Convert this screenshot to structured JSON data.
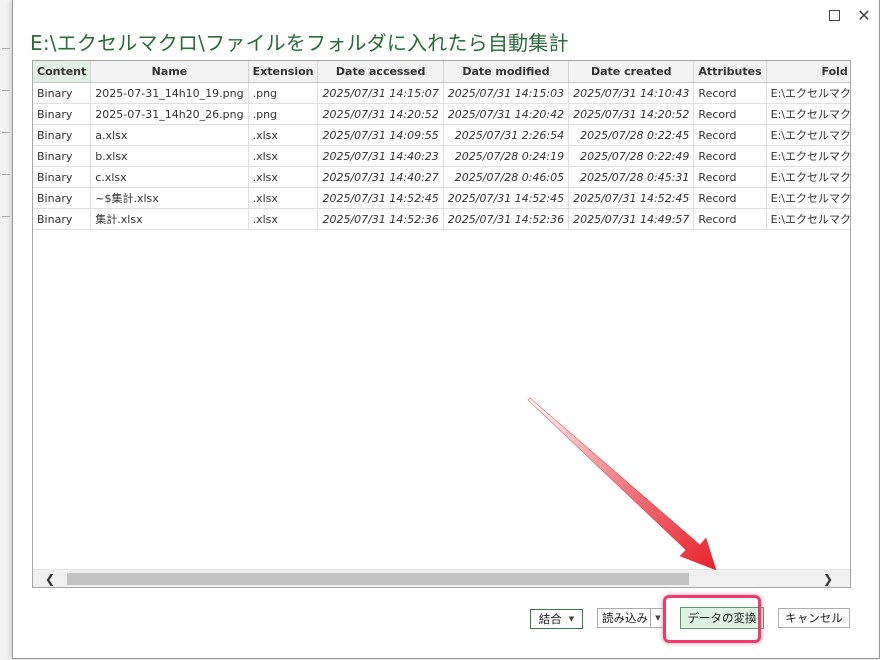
{
  "window": {
    "title": "E:\\エクセルマクロ\\ファイルをフォルダに入れたら自動集計",
    "controls": {
      "maximize_icon": "maximize-icon",
      "close_icon": "close-icon",
      "close_glyph": "✕"
    }
  },
  "table": {
    "columns": [
      "Content",
      "Name",
      "Extension",
      "Date accessed",
      "Date modified",
      "Date created",
      "Attributes",
      "Fold"
    ],
    "rows": [
      {
        "content": "Binary",
        "name": "2025-07-31_14h10_19.png",
        "extension": ".png",
        "date_accessed": "2025/07/31 14:15:07",
        "date_modified": "2025/07/31 14:15:03",
        "date_created": "2025/07/31 14:10:43",
        "attributes": "Record",
        "folder": "E:\\エクセルマクロ\\ファイ"
      },
      {
        "content": "Binary",
        "name": "2025-07-31_14h20_26.png",
        "extension": ".png",
        "date_accessed": "2025/07/31 14:20:52",
        "date_modified": "2025/07/31 14:20:42",
        "date_created": "2025/07/31 14:20:52",
        "attributes": "Record",
        "folder": "E:\\エクセルマクロ\\ファイ"
      },
      {
        "content": "Binary",
        "name": "a.xlsx",
        "extension": ".xlsx",
        "date_accessed": "2025/07/31 14:09:55",
        "date_modified": "2025/07/31 2:26:54",
        "date_created": "2025/07/28 0:22:45",
        "attributes": "Record",
        "folder": "E:\\エクセルマクロ\\ファイ"
      },
      {
        "content": "Binary",
        "name": "b.xlsx",
        "extension": ".xlsx",
        "date_accessed": "2025/07/31 14:40:23",
        "date_modified": "2025/07/28 0:24:19",
        "date_created": "2025/07/28 0:22:49",
        "attributes": "Record",
        "folder": "E:\\エクセルマクロ\\ファイ"
      },
      {
        "content": "Binary",
        "name": "c.xlsx",
        "extension": ".xlsx",
        "date_accessed": "2025/07/31 14:40:27",
        "date_modified": "2025/07/28 0:46:05",
        "date_created": "2025/07/28 0:45:31",
        "attributes": "Record",
        "folder": "E:\\エクセルマクロ\\ファイ"
      },
      {
        "content": "Binary",
        "name": "~$集計.xlsx",
        "extension": ".xlsx",
        "date_accessed": "2025/07/31 14:52:45",
        "date_modified": "2025/07/31 14:52:45",
        "date_created": "2025/07/31 14:52:45",
        "attributes": "Record",
        "folder": "E:\\エクセルマクロ\\ファイ"
      },
      {
        "content": "Binary",
        "name": "集計.xlsx",
        "extension": ".xlsx",
        "date_accessed": "2025/07/31 14:52:36",
        "date_modified": "2025/07/31 14:52:36",
        "date_created": "2025/07/31 14:49:57",
        "attributes": "Record",
        "folder": "E:\\エクセルマクロ\\ファイ"
      }
    ]
  },
  "scrollbar": {
    "left_glyph": "❮",
    "right_glyph": "❯"
  },
  "footer": {
    "combine_label": "結合",
    "dropdown_glyph": "▼",
    "load_label": "読み込み",
    "transform_label": "データの変換",
    "cancel_label": "キャンセル"
  },
  "colors": {
    "title": "#2c6b3a",
    "annotation_arrow": "#e8202a",
    "annotation_box": "#ee3a6e",
    "primary_button": "#dff2e3"
  }
}
